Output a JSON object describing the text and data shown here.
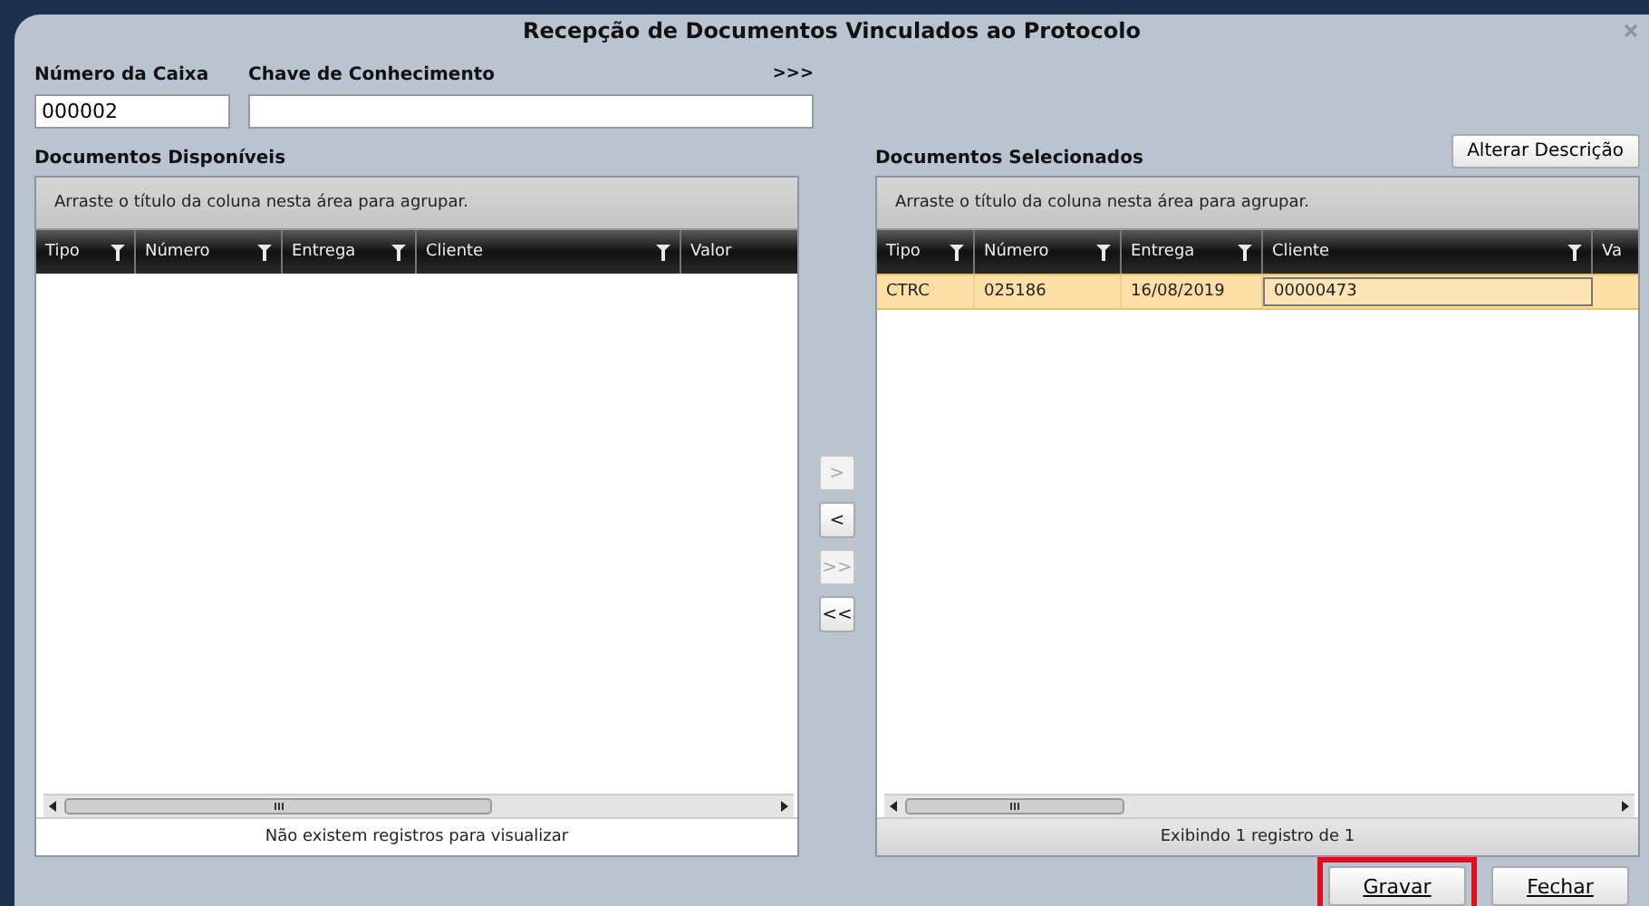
{
  "window": {
    "title": "Recepção de Documentos Vinculados ao Protocolo"
  },
  "fields": [
    {
      "label": "Número da Caixa",
      "value": "000002"
    },
    {
      "label": "Chave de Conhecimento"
    }
  ],
  "expand_link": ">>>",
  "available": {
    "title": "Documentos Disponíveis",
    "group_hint": "Arraste o título da coluna nesta área para agrupar.",
    "columns": [
      "Tipo",
      "Número",
      "Entrega",
      "Cliente",
      "Valor"
    ],
    "footer": "Não existem registros para visualizar"
  },
  "transfer_buttons": [
    {
      "label": ">",
      "disabled": true
    },
    {
      "label": "<",
      "disabled": false
    },
    {
      "label": ">>",
      "disabled": true
    },
    {
      "label": "<<",
      "disabled": false
    }
  ],
  "selected_docs": {
    "title": "Documentos Selecionados",
    "action_button": "Alterar Descrição",
    "group_hint": "Arraste o título da coluna nesta área para agrupar.",
    "columns": [
      "Tipo",
      "Número",
      "Entrega",
      "Cliente",
      "Va"
    ],
    "rows": [
      {
        "cells": [
          "CTRC",
          "025186",
          "16/08/2019",
          "00000473"
        ],
        "selected": true
      }
    ],
    "footer": "Exibindo 1 registro de 1"
  },
  "buttons": [
    {
      "label": "Gravar",
      "highlighted": true
    },
    {
      "label": "Fechar",
      "highlighted": false
    }
  ]
}
